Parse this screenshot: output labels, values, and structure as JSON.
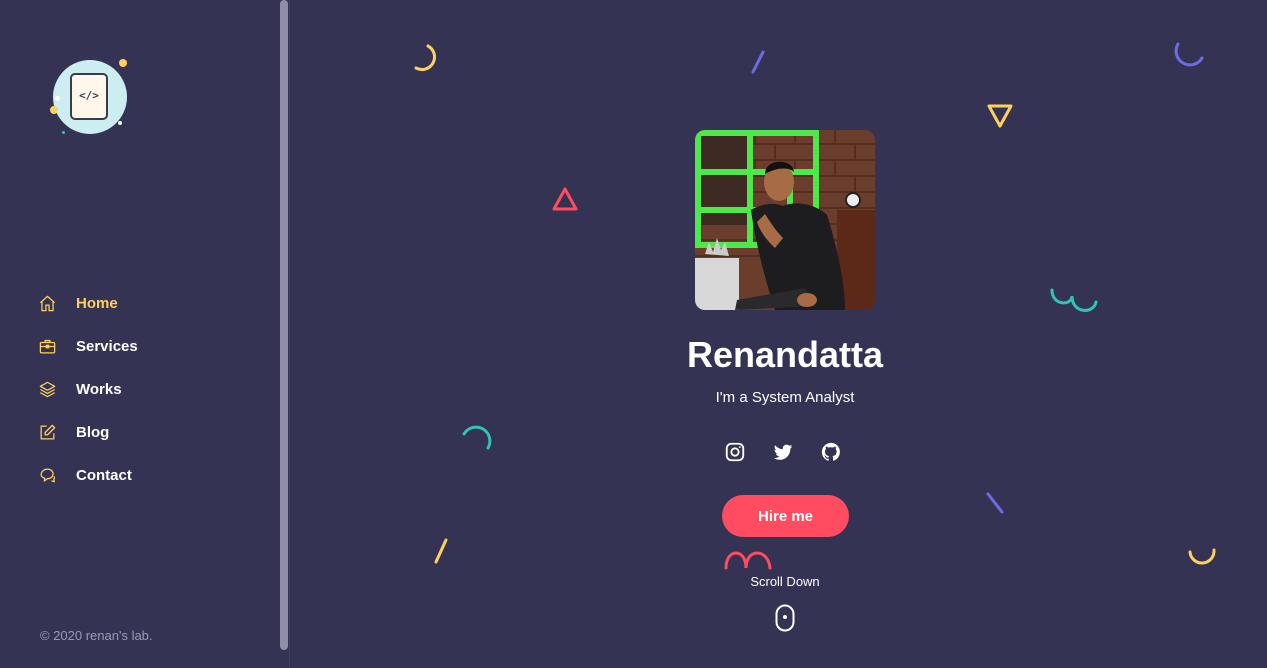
{
  "sidebar": {
    "logo_icon": "code-file-icon",
    "nav": [
      {
        "label": "Home",
        "icon": "home-icon",
        "active": true
      },
      {
        "label": "Services",
        "icon": "briefcase-icon",
        "active": false
      },
      {
        "label": "Works",
        "icon": "layers-icon",
        "active": false
      },
      {
        "label": "Blog",
        "icon": "edit-icon",
        "active": false
      },
      {
        "label": "Contact",
        "icon": "chat-icon",
        "active": false
      }
    ],
    "copyright": "© 2020 renan's lab."
  },
  "hero": {
    "name": "Renandatta",
    "tagline": "I'm a System Analyst",
    "socials": [
      "instagram-icon",
      "twitter-icon",
      "github-icon"
    ],
    "hire_label": "Hire me",
    "scroll_label": "Scroll Down"
  },
  "colors": {
    "background": "#353353",
    "accent": "#ffd15c",
    "button": "#ff4c60",
    "teal": "#2ec4b6",
    "purple": "#6c6ce5"
  }
}
